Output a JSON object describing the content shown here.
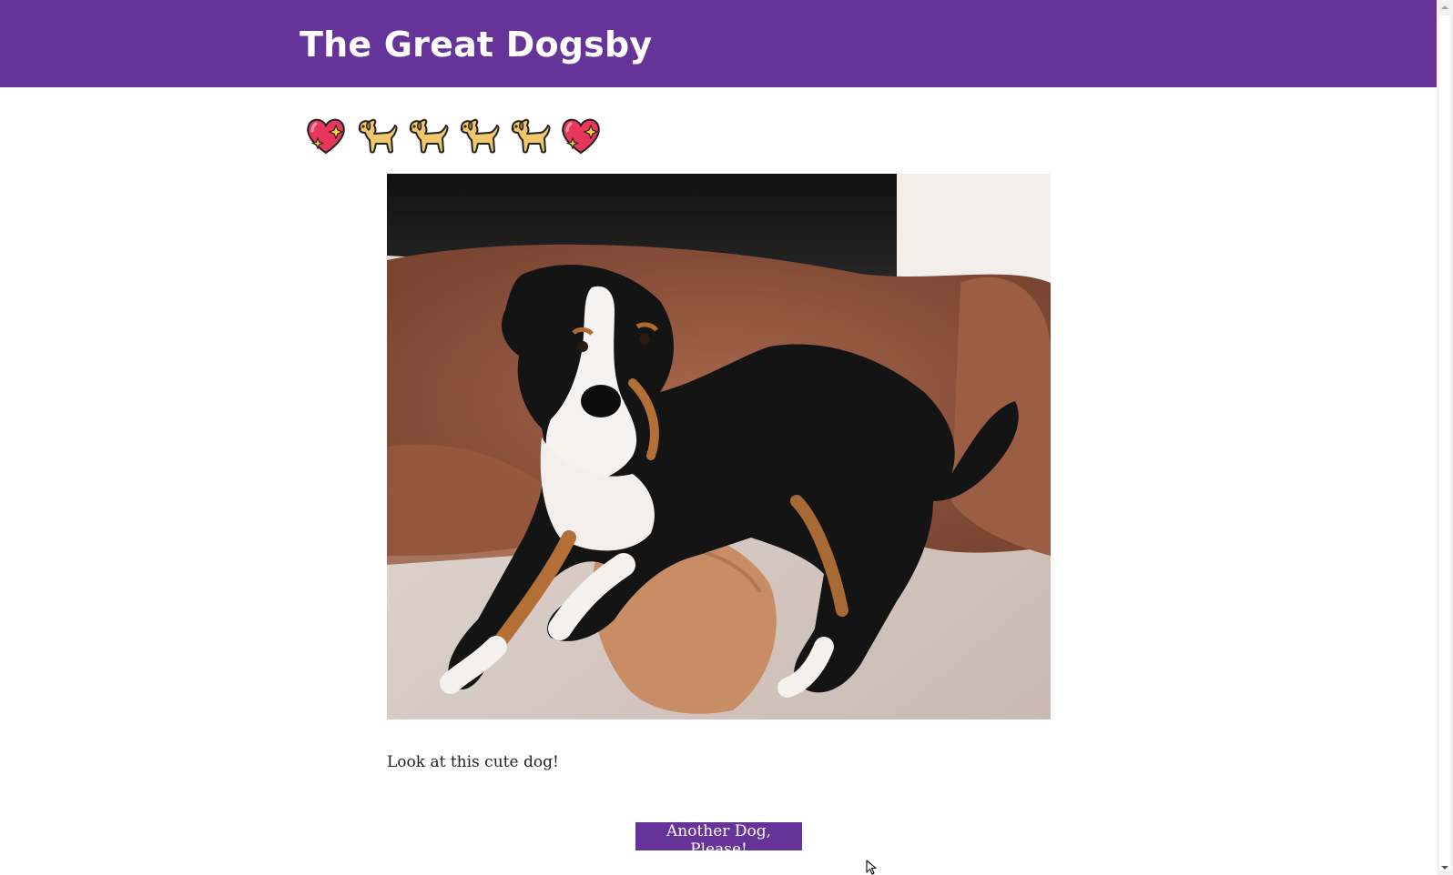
{
  "header": {
    "title": "The Great Dogsby",
    "background_color": "#663399"
  },
  "emoji_row": {
    "icons": [
      "sparkling-heart-icon",
      "dog-icon",
      "dog-icon",
      "dog-icon",
      "dog-icon",
      "sparkling-heart-icon"
    ]
  },
  "main": {
    "photo": {
      "subject": "tricolor-puppy-photo"
    },
    "caption": "Look at this cute dog!",
    "another_button_label": "Another Dog, Please!"
  },
  "colors": {
    "accent": "#663399",
    "text": "#222222",
    "page_background": "#ffffff"
  }
}
